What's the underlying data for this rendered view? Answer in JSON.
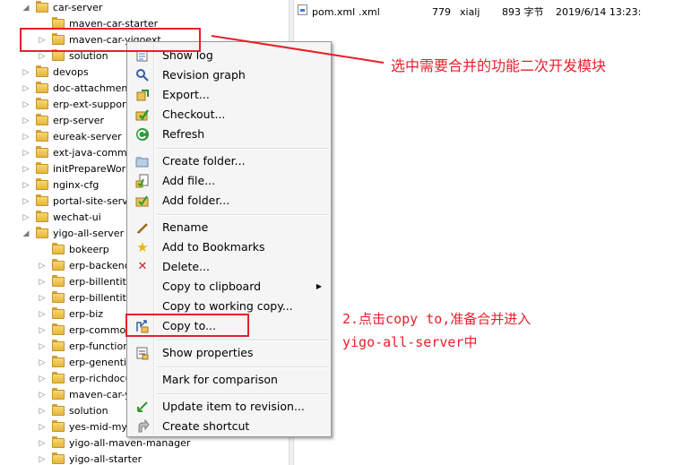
{
  "tree": {
    "items": [
      {
        "label": "car-server",
        "depth": 1,
        "expanded": true
      },
      {
        "label": "maven-car-starter",
        "depth": 2,
        "expanded": false,
        "leaf": true
      },
      {
        "label": "maven-car-yigoext",
        "depth": 2,
        "expanded": false
      },
      {
        "label": "solution",
        "depth": 2,
        "expanded": false
      },
      {
        "label": "devops",
        "depth": 1,
        "expanded": false
      },
      {
        "label": "doc-attachment",
        "depth": 1,
        "expanded": false
      },
      {
        "label": "erp-ext-support",
        "depth": 1,
        "expanded": false
      },
      {
        "label": "erp-server",
        "depth": 1,
        "expanded": false
      },
      {
        "label": "eureak-server",
        "depth": 1,
        "expanded": false
      },
      {
        "label": "ext-java-common",
        "depth": 1,
        "expanded": false
      },
      {
        "label": "initPrepareWork",
        "depth": 1,
        "expanded": false
      },
      {
        "label": "nginx-cfg",
        "depth": 1,
        "expanded": false
      },
      {
        "label": "portal-site-server",
        "depth": 1,
        "expanded": false
      },
      {
        "label": "wechat-ui",
        "depth": 1,
        "expanded": false
      },
      {
        "label": "yigo-all-server",
        "depth": 1,
        "expanded": true
      },
      {
        "label": "bokeerp",
        "depth": 2,
        "expanded": false,
        "leaf": true
      },
      {
        "label": "erp-backend-s",
        "depth": 2,
        "expanded": false
      },
      {
        "label": "erp-billentity",
        "depth": 2,
        "expanded": false
      },
      {
        "label": "erp-billentity-b",
        "depth": 2,
        "expanded": false
      },
      {
        "label": "erp-biz",
        "depth": 2,
        "expanded": false
      },
      {
        "label": "erp-common",
        "depth": 2,
        "expanded": false
      },
      {
        "label": "erp-function",
        "depth": 2,
        "expanded": false
      },
      {
        "label": "erp-genentity",
        "depth": 2,
        "expanded": false
      },
      {
        "label": "erp-richdocum",
        "depth": 2,
        "expanded": false
      },
      {
        "label": "maven-car-yig",
        "depth": 2,
        "expanded": false
      },
      {
        "label": "solution",
        "depth": 2,
        "expanded": false
      },
      {
        "label": "yes-mid-mysql",
        "depth": 2,
        "expanded": false
      },
      {
        "label": "yigo-all-maven-manager",
        "depth": 2,
        "expanded": false
      },
      {
        "label": "yigo-all-starter",
        "depth": 2,
        "expanded": false
      }
    ]
  },
  "files": {
    "rows": [
      {
        "name": "pom.xml",
        "ext": ".xml",
        "rev": "779",
        "author": "xialj",
        "size": "893 字节",
        "date": "2019/6/14 13:23:"
      }
    ]
  },
  "context_menu": {
    "items": [
      {
        "label": "Show log",
        "icon": "show-log-icon"
      },
      {
        "label": "Revision graph",
        "icon": "revision-graph-icon"
      },
      {
        "label": "Export...",
        "icon": "export-icon"
      },
      {
        "label": "Checkout...",
        "icon": "checkout-icon"
      },
      {
        "label": "Refresh",
        "icon": "refresh-icon"
      },
      {
        "label": "Create folder...",
        "icon": "create-folder-icon"
      },
      {
        "label": "Add file...",
        "icon": "add-file-icon"
      },
      {
        "label": "Add folder...",
        "icon": "add-folder-icon"
      },
      {
        "label": "Rename",
        "icon": "rename-icon"
      },
      {
        "label": "Add to Bookmarks",
        "icon": "star-icon"
      },
      {
        "label": "Delete...",
        "icon": "delete-icon"
      },
      {
        "label": "Copy to clipboard",
        "icon": "",
        "submenu": true
      },
      {
        "label": "Copy to working copy...",
        "icon": ""
      },
      {
        "label": "Copy to...",
        "icon": "copy-to-icon"
      },
      {
        "label": "Show properties",
        "icon": "properties-icon"
      },
      {
        "label": "Mark for comparison",
        "icon": ""
      },
      {
        "label": "Update item to revision...",
        "icon": "update-icon"
      },
      {
        "label": "Create shortcut",
        "icon": "shortcut-icon"
      }
    ]
  },
  "annotations": {
    "note1": "选中需要合并的功能二次开发模块",
    "note2_line1": "2.点击copy to,准备合并进入",
    "note2_line2": "yigo-all-server中"
  },
  "colors": {
    "annotation": "#e8202a",
    "folder": "#e6b63a",
    "menu_bg": "#f5f5f5"
  }
}
